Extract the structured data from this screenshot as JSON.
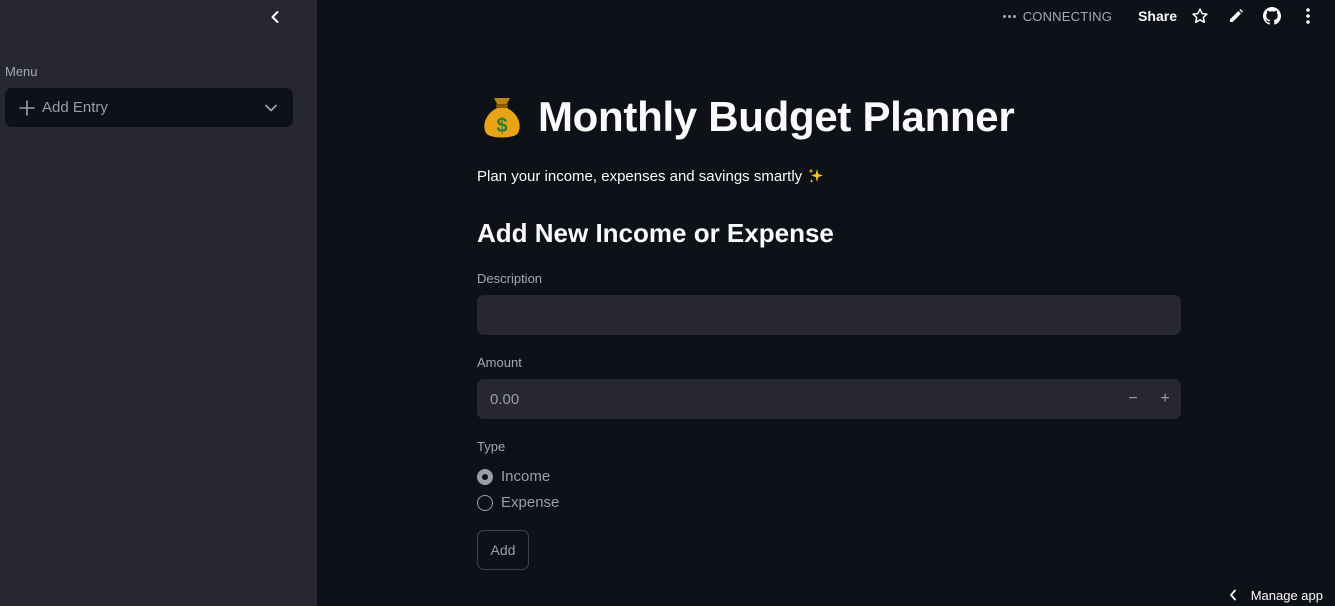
{
  "sidebar": {
    "menu_label": "Menu",
    "nav_selected": "Add Entry",
    "icons": [
      "chevron-left-icon",
      "plus-icon",
      "chevron-down-icon"
    ]
  },
  "topbar": {
    "status": "CONNECTING",
    "share_label": "Share",
    "icons": [
      "star-icon",
      "pencil-icon",
      "github-icon",
      "kebab-menu-icon"
    ]
  },
  "main": {
    "title": "Monthly Budget Planner",
    "title_icon": "money-bag-icon",
    "subtitle": "Plan your income, expenses and savings smartly",
    "subtitle_icon": "sparkles-icon",
    "section_title": "Add New Income or Expense",
    "description": {
      "label": "Description",
      "value": ""
    },
    "amount": {
      "label": "Amount",
      "value": "0.00",
      "minus": "−",
      "plus": "+"
    },
    "type": {
      "label": "Type",
      "options": [
        "Income",
        "Expense"
      ],
      "selected": "Income"
    },
    "add_button": "Add"
  },
  "footer": {
    "manage_app": "Manage app"
  },
  "colors": {
    "background": "#0e1117",
    "sidebar": "#262730",
    "input_bg": "#262730",
    "text": "#fafafa",
    "muted": "#a3a8b4"
  }
}
